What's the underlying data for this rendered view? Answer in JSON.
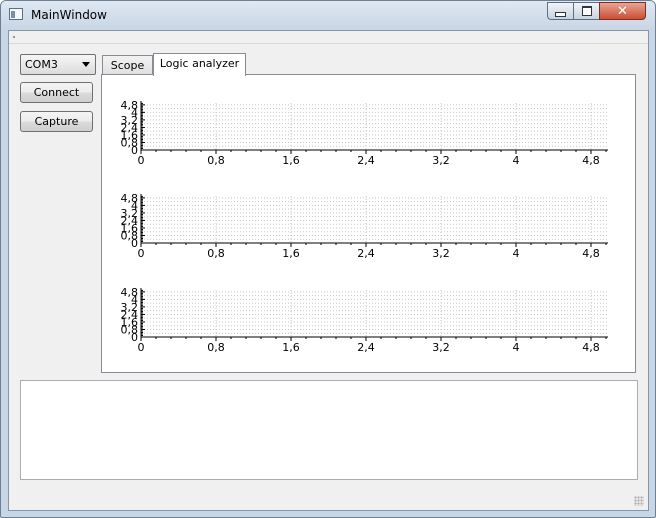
{
  "window": {
    "title": "MainWindow"
  },
  "controls": {
    "port_selected": "COM3",
    "connect_label": "Connect",
    "capture_label": "Capture"
  },
  "tabs": [
    {
      "label": "Scope",
      "active": false
    },
    {
      "label": "Logic analyzer",
      "active": true
    }
  ],
  "chart_data": [
    {
      "type": "line",
      "series": [],
      "xlim": [
        0,
        5
      ],
      "ylim": [
        0,
        5
      ],
      "x_ticks": [
        "0",
        "0,8",
        "1,6",
        "2,4",
        "3,2",
        "4",
        "4,8"
      ],
      "y_ticks": [
        "0",
        "0,8",
        "1,6",
        "2,4",
        "3,2",
        "4",
        "4,8"
      ],
      "grid": true
    },
    {
      "type": "line",
      "series": [],
      "xlim": [
        0,
        5
      ],
      "ylim": [
        0,
        5
      ],
      "x_ticks": [
        "0",
        "0,8",
        "1,6",
        "2,4",
        "3,2",
        "4",
        "4,8"
      ],
      "y_ticks": [
        "0",
        "0,8",
        "1,6",
        "2,4",
        "3,2",
        "4",
        "4,8"
      ],
      "grid": true
    },
    {
      "type": "line",
      "series": [],
      "xlim": [
        0,
        5
      ],
      "ylim": [
        0,
        5
      ],
      "x_ticks": [
        "0",
        "0,8",
        "1,6",
        "2,4",
        "3,2",
        "4",
        "4,8"
      ],
      "y_ticks": [
        "0",
        "0,8",
        "1,6",
        "2,4",
        "3,2",
        "4",
        "4,8"
      ],
      "grid": true
    }
  ],
  "output": {
    "text": ""
  }
}
